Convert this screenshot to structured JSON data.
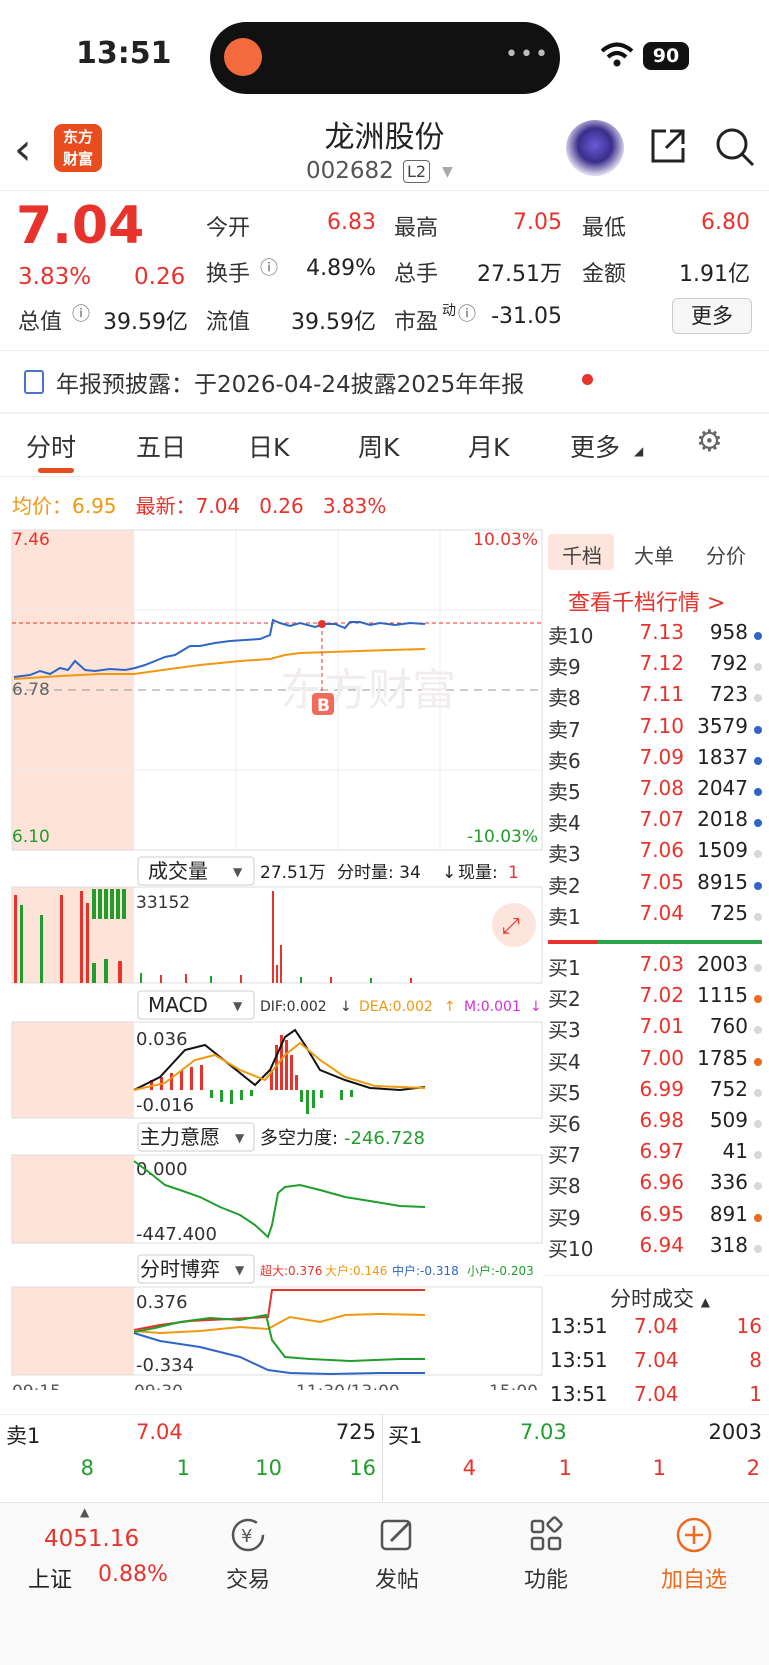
{
  "status_bar": {
    "time": "13:51",
    "battery": "90"
  },
  "header": {
    "name": "龙洲股份",
    "code": "002682",
    "badge": "L2",
    "logo_line1": "东方",
    "logo_line2": "财富"
  },
  "quote": {
    "price": "7.04",
    "change_pct": "3.83%",
    "change_amt": "0.26",
    "open_label": "今开",
    "open": "6.83",
    "high_label": "最高",
    "high": "7.05",
    "low_label": "最低",
    "low": "6.80",
    "turnover_label": "换手",
    "turnover": "4.89%",
    "volume_label": "总手",
    "volume": "27.51万",
    "amount_label": "金额",
    "amount": "1.91亿",
    "mcap_label": "总值",
    "mcap": "39.59亿",
    "float_label": "流值",
    "float_cap": "39.59亿",
    "pe_label": "市盈",
    "pe_sup": "动",
    "pe": "-31.05",
    "more": "更多"
  },
  "notice": "年报预披露：于2026-04-24披露2025年年报",
  "tabs": [
    "分时",
    "五日",
    "日K",
    "周K",
    "月K",
    "更多"
  ],
  "intraday": {
    "avg_label": "均价：",
    "avg": "6.95",
    "latest_label": "最新：",
    "latest": "7.04",
    "chg": "0.26",
    "pct": "3.83%",
    "top_price": "7.46",
    "top_pct": "10.03%",
    "mid_price": "6.78",
    "bottom_price": "6.10",
    "bottom_pct": "-10.03%",
    "b_marker": "B"
  },
  "volume_panel": {
    "name": "成交量",
    "total": "27.51万",
    "tick_label": "分时量: 34",
    "now_label": "现量:",
    "now": "1",
    "max": "33152"
  },
  "macd_panel": {
    "name": "MACD",
    "dif": "DIF:0.002",
    "dea": "DEA:0.002",
    "m": "M:0.001",
    "max": "0.036",
    "min": "-0.016"
  },
  "main_force_panel": {
    "name": "主力意愿",
    "label": "多空力度:",
    "value": "-246.728",
    "max": "0.000",
    "min": "-447.400"
  },
  "game_panel": {
    "name": "分时博弈",
    "xl": "超大:0.376",
    "l": "大户:0.146",
    "m": "中户:-0.318",
    "s": "小户:-0.203",
    "max": "0.376",
    "min": "-0.334"
  },
  "time_axis": [
    "09:15",
    "09:30",
    "11:30/13:00",
    "15:00"
  ],
  "right_panel": {
    "tabs": [
      "千档",
      "大单",
      "分价"
    ],
    "link": "查看千档行情 >",
    "asks": [
      {
        "label": "卖10",
        "price": "7.13",
        "vol": "958",
        "dot": "#2f66c6"
      },
      {
        "label": "卖9",
        "price": "7.12",
        "vol": "792",
        "dot": "#d8d8d8"
      },
      {
        "label": "卖8",
        "price": "7.11",
        "vol": "723",
        "dot": "#d8d8d8"
      },
      {
        "label": "卖7",
        "price": "7.10",
        "vol": "3579",
        "dot": "#2f66c6"
      },
      {
        "label": "卖6",
        "price": "7.09",
        "vol": "1837",
        "dot": "#2f66c6"
      },
      {
        "label": "卖5",
        "price": "7.08",
        "vol": "2047",
        "dot": "#2f66c6"
      },
      {
        "label": "卖4",
        "price": "7.07",
        "vol": "2018",
        "dot": "#2f66c6"
      },
      {
        "label": "卖3",
        "price": "7.06",
        "vol": "1509",
        "dot": "#d8d8d8"
      },
      {
        "label": "卖2",
        "price": "7.05",
        "vol": "8915",
        "dot": "#2f66c6"
      },
      {
        "label": "卖1",
        "price": "7.04",
        "vol": "725",
        "dot": "#d8d8d8"
      }
    ],
    "bids": [
      {
        "label": "买1",
        "price": "7.03",
        "vol": "2003",
        "dot": "#d8d8d8"
      },
      {
        "label": "买2",
        "price": "7.02",
        "vol": "1115",
        "dot": "#ef6a1e"
      },
      {
        "label": "买3",
        "price": "7.01",
        "vol": "760",
        "dot": "#d8d8d8"
      },
      {
        "label": "买4",
        "price": "7.00",
        "vol": "1785",
        "dot": "#ef6a1e"
      },
      {
        "label": "买5",
        "price": "6.99",
        "vol": "752",
        "dot": "#d8d8d8"
      },
      {
        "label": "买6",
        "price": "6.98",
        "vol": "509",
        "dot": "#d8d8d8"
      },
      {
        "label": "买7",
        "price": "6.97",
        "vol": "41",
        "dot": "#d8d8d8"
      },
      {
        "label": "买8",
        "price": "6.96",
        "vol": "336",
        "dot": "#d8d8d8"
      },
      {
        "label": "买9",
        "price": "6.95",
        "vol": "891",
        "dot": "#ef6a1e"
      },
      {
        "label": "买10",
        "price": "6.94",
        "vol": "318",
        "dot": "#d8d8d8"
      }
    ],
    "trades_title": "分时成交",
    "trades": [
      {
        "time": "13:51",
        "price": "7.04",
        "vol": "16"
      },
      {
        "time": "13:51",
        "price": "7.04",
        "vol": "8"
      },
      {
        "time": "13:51",
        "price": "7.04",
        "vol": "1"
      }
    ]
  },
  "level1": {
    "sell_label": "卖1",
    "sell_price": "7.04",
    "sell_vol": "725",
    "buy_label": "买1",
    "buy_price": "7.03",
    "buy_vol": "2003",
    "sell_ticks": [
      "8",
      "1",
      "10",
      "16"
    ],
    "buy_ticks": [
      "4",
      "1",
      "1",
      "2"
    ]
  },
  "tabbar": {
    "index_value": "4051.16",
    "index_name": "上证",
    "index_pct": "0.88%",
    "items": [
      "交易",
      "发帖",
      "功能",
      "加自选"
    ]
  },
  "colors": {
    "up": "#e8322c",
    "down": "#1f9e2c",
    "accent": "#e94c1e",
    "avg_line": "#f0980f",
    "price_line": "#2f66c6"
  }
}
